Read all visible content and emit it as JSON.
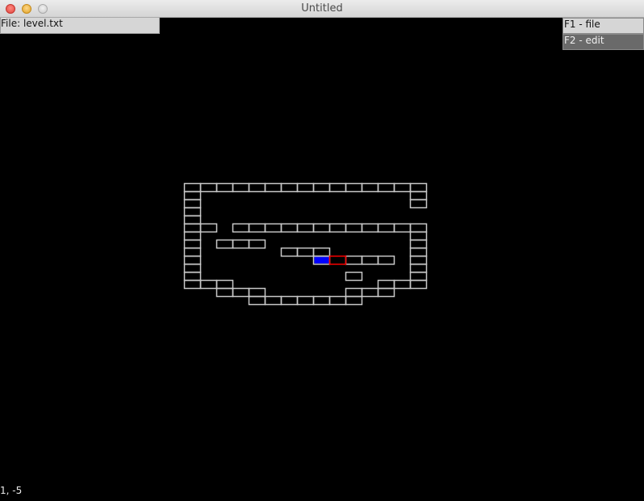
{
  "window": {
    "title": "Untitled"
  },
  "file_label": "File: level.txt",
  "menu": {
    "items": [
      {
        "label": "F1 - file"
      },
      {
        "label": "F2 - edit"
      }
    ]
  },
  "status": {
    "coords": "1, -5"
  },
  "colors": {
    "background": "#000000",
    "tile_outline": "#c8c8c8",
    "player": "#0000ff",
    "cursor": "#ff0000"
  },
  "level": {
    "tiles": [
      [
        0,
        0
      ],
      [
        1,
        0
      ],
      [
        2,
        0
      ],
      [
        3,
        0
      ],
      [
        4,
        0
      ],
      [
        5,
        0
      ],
      [
        6,
        0
      ],
      [
        7,
        0
      ],
      [
        8,
        0
      ],
      [
        9,
        0
      ],
      [
        10,
        0
      ],
      [
        11,
        0
      ],
      [
        12,
        0
      ],
      [
        13,
        0
      ],
      [
        14,
        0
      ],
      [
        0,
        1
      ],
      [
        14,
        1
      ],
      [
        0,
        2
      ],
      [
        14,
        2
      ],
      [
        0,
        3
      ],
      [
        0,
        4
      ],
      [
        0,
        5
      ],
      [
        1,
        5
      ],
      [
        3,
        5
      ],
      [
        4,
        5
      ],
      [
        5,
        5
      ],
      [
        6,
        5
      ],
      [
        7,
        5
      ],
      [
        8,
        5
      ],
      [
        9,
        5
      ],
      [
        10,
        5
      ],
      [
        11,
        5
      ],
      [
        12,
        5
      ],
      [
        13,
        5
      ],
      [
        14,
        5
      ],
      [
        0,
        6
      ],
      [
        14,
        6
      ],
      [
        0,
        7
      ],
      [
        2,
        7
      ],
      [
        3,
        7
      ],
      [
        4,
        7
      ],
      [
        14,
        7
      ],
      [
        0,
        8
      ],
      [
        6,
        8
      ],
      [
        7,
        8
      ],
      [
        8,
        8
      ],
      [
        14,
        8
      ],
      [
        0,
        9
      ],
      [
        8,
        9
      ],
      [
        10,
        9
      ],
      [
        11,
        9
      ],
      [
        12,
        9
      ],
      [
        14,
        9
      ],
      [
        0,
        10
      ],
      [
        14,
        10
      ],
      [
        0,
        11
      ],
      [
        10,
        11
      ],
      [
        14,
        11
      ],
      [
        0,
        12
      ],
      [
        1,
        12
      ],
      [
        2,
        12
      ],
      [
        12,
        12
      ],
      [
        13,
        12
      ],
      [
        14,
        12
      ],
      [
        2,
        13
      ],
      [
        3,
        13
      ],
      [
        4,
        13
      ],
      [
        10,
        13
      ],
      [
        11,
        13
      ],
      [
        12,
        13
      ],
      [
        4,
        14
      ],
      [
        5,
        14
      ],
      [
        6,
        14
      ],
      [
        7,
        14
      ],
      [
        8,
        14
      ],
      [
        9,
        14
      ],
      [
        10,
        14
      ]
    ],
    "player": [
      8,
      9
    ],
    "cursor": [
      9,
      9
    ]
  }
}
